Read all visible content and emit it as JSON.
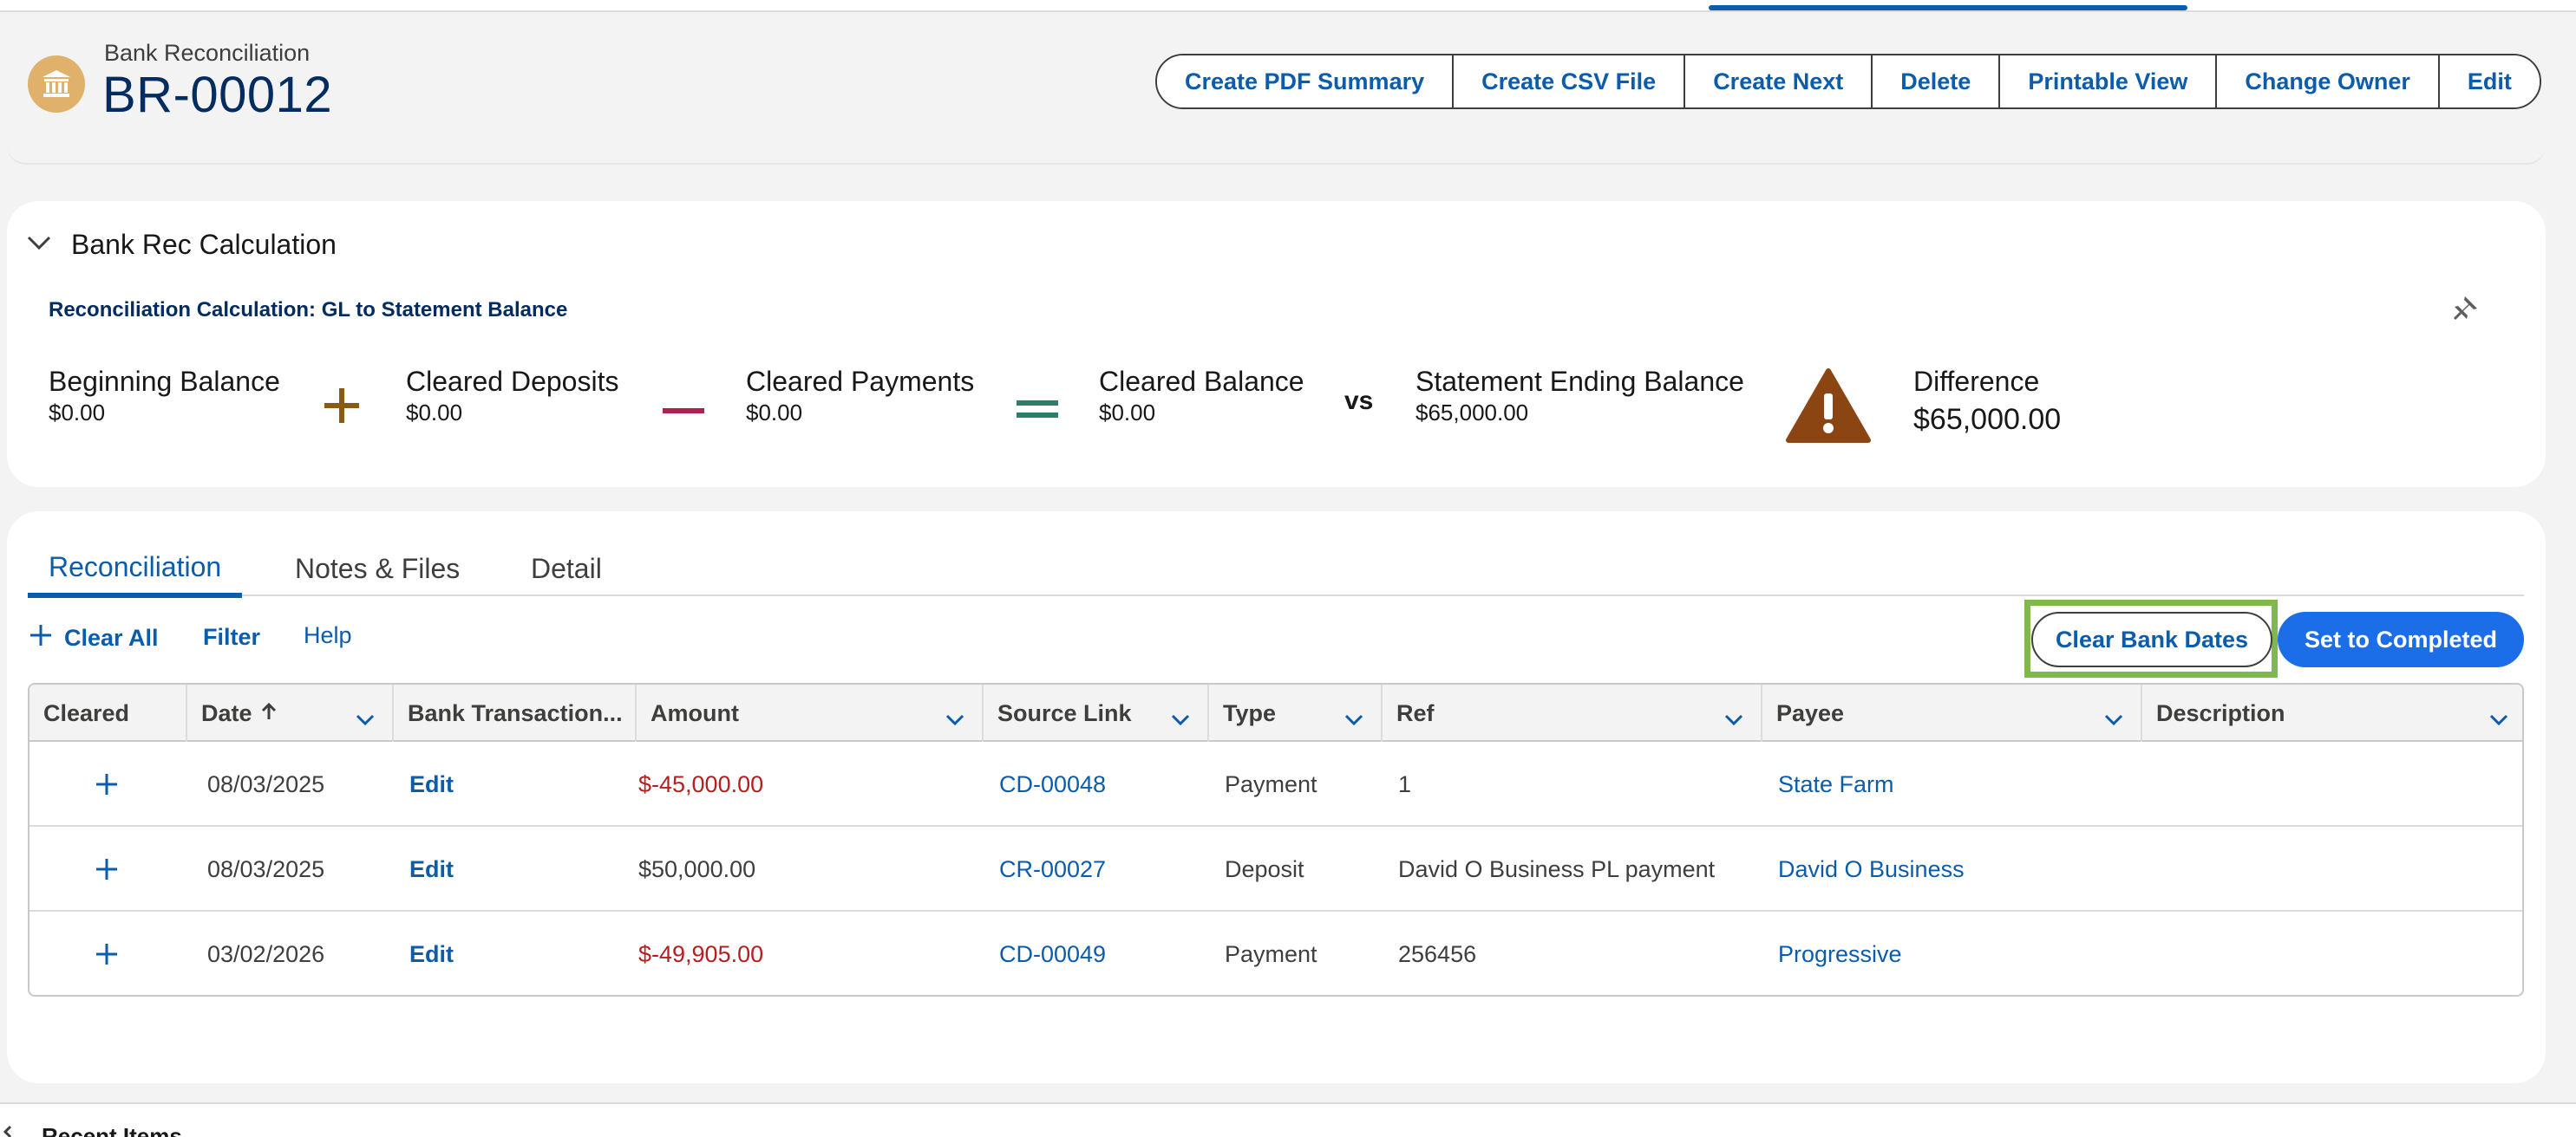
{
  "header": {
    "object_label": "Bank Reconciliation",
    "record_name": "BR-00012",
    "buttons": [
      "Create PDF Summary",
      "Create CSV File",
      "Create Next",
      "Delete",
      "Printable View",
      "Change Owner",
      "Edit"
    ]
  },
  "calc": {
    "section_title": "Bank Rec Calculation",
    "subtitle": "Reconciliation Calculation: GL to Statement Balance",
    "beginning_label": "Beginning Balance",
    "beginning_value": "$0.00",
    "deposits_label": "Cleared Deposits",
    "deposits_value": "$0.00",
    "payments_label": "Cleared Payments",
    "payments_value": "$0.00",
    "cleared_label": "Cleared Balance",
    "cleared_value": "$0.00",
    "vs": "vs",
    "statement_label": "Statement Ending Balance",
    "statement_value": "$65,000.00",
    "difference_label": "Difference",
    "difference_value": "$65,000.00"
  },
  "tabs": [
    "Reconciliation",
    "Notes & Files",
    "Detail"
  ],
  "actions": {
    "clear_all": "Clear All",
    "filter": "Filter",
    "help": "Help",
    "clear_bank_dates": "Clear Bank Dates",
    "set_completed": "Set to Completed"
  },
  "table": {
    "columns": [
      "Cleared",
      "Date",
      "Bank Transaction...",
      "Amount",
      "Source Link",
      "Type",
      "Ref",
      "Payee",
      "Description"
    ],
    "rows": [
      {
        "date": "08/03/2025",
        "bank_transaction": "Edit",
        "amount": "$-45,000.00",
        "source_link": "CD-00048",
        "type": "Payment",
        "ref": "1",
        "payee": "State Farm",
        "description": ""
      },
      {
        "date": "08/03/2025",
        "bank_transaction": "Edit",
        "amount": "$50,000.00",
        "source_link": "CR-00027",
        "type": "Deposit",
        "ref": "David O Business PL payment",
        "payee": "David O Business",
        "description": ""
      },
      {
        "date": "03/02/2026",
        "bank_transaction": "Edit",
        "amount": "$-49,905.00",
        "source_link": "CD-00049",
        "type": "Payment",
        "ref": "256456",
        "payee": "Progressive",
        "description": ""
      }
    ]
  },
  "footer": {
    "recent_items": "Recent Items"
  },
  "icons": {
    "record": "bank-building-icon",
    "toggle": "chevron-down-icon",
    "pin": "pin-icon",
    "warning": "warning-icon",
    "sort": "arrow-up-icon",
    "add": "plus-icon",
    "recent": "undo-icon"
  },
  "colors": {
    "brand_blue": "#0b5cab",
    "primary_button": "#1b6ee8",
    "plus_operator": "#8b5a14",
    "minus_operator": "#b0224e",
    "equals_operator": "#2e7d6b",
    "warning": "#8b4513",
    "negative_amount": "#b51f1f",
    "highlight": "#7fb84e"
  }
}
